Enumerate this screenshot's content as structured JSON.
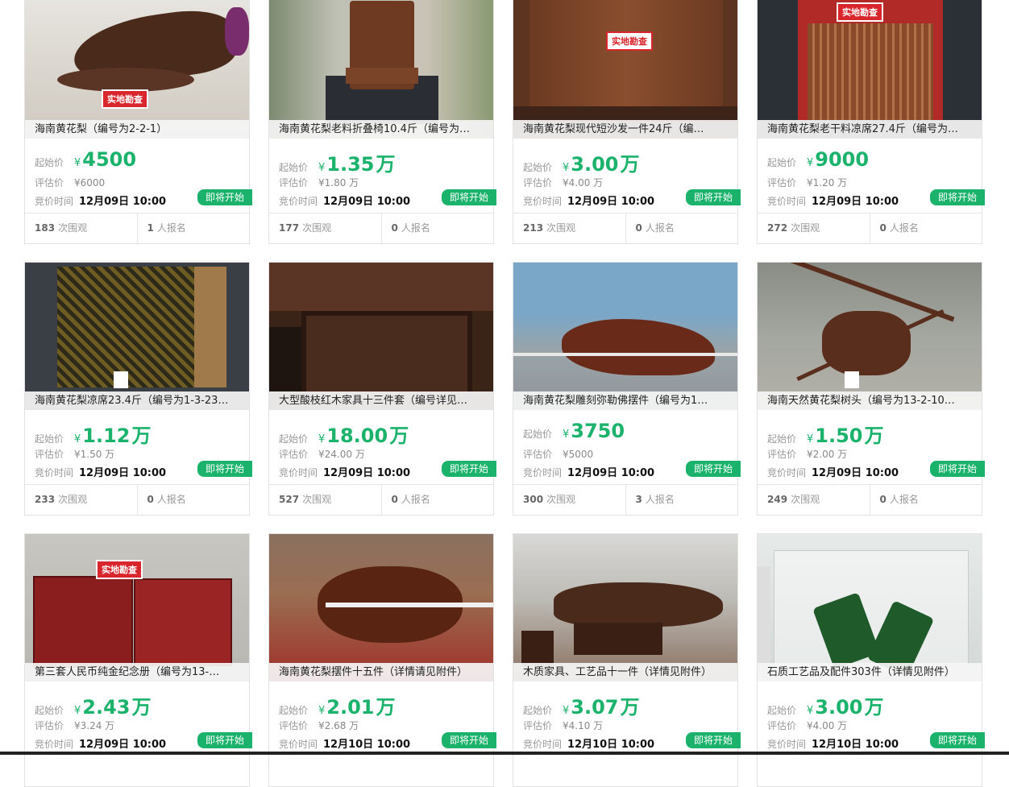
{
  "labels": {
    "start_price": "起始价",
    "eval_price": "评估价",
    "bid_time": "竞价时间",
    "yen": "¥",
    "status": "即将开始",
    "views_suffix": "次围观",
    "signup_suffix": "人报名"
  },
  "sign_text": "实地勘查",
  "colors": {
    "accent": "#1bb36b",
    "sign": "#d8262c"
  },
  "items": [
    {
      "title": "海南黄花梨（编号为2-2-1）",
      "price_num": "4500",
      "price_unit": "",
      "eval": "¥6000",
      "time": "12月09日 10:00",
      "views": "183",
      "signups": "1"
    },
    {
      "title": "海南黄花梨老料折叠椅10.4斤（编号为…",
      "price_num": "1.35",
      "price_unit": "万",
      "eval": "¥1.80 万",
      "time": "12月09日 10:00",
      "views": "177",
      "signups": "0"
    },
    {
      "title": "海南黄花梨现代短沙发一件24斤（编…",
      "price_num": "3.00",
      "price_unit": "万",
      "eval": "¥4.00 万",
      "time": "12月09日 10:00",
      "views": "213",
      "signups": "0"
    },
    {
      "title": "海南黄花梨老干料凉席27.4斤（编号为…",
      "price_num": "9000",
      "price_unit": "",
      "eval": "¥1.20 万",
      "time": "12月09日 10:00",
      "views": "272",
      "signups": "0"
    },
    {
      "title": "海南黄花梨凉席23.4斤（编号为1-3-23…",
      "price_num": "1.12",
      "price_unit": "万",
      "eval": "¥1.50 万",
      "time": "12月09日 10:00",
      "views": "233",
      "signups": "0"
    },
    {
      "title": "大型酸枝红木家具十三件套（编号详见…",
      "price_num": "18.00",
      "price_unit": "万",
      "eval": "¥24.00 万",
      "time": "12月09日 10:00",
      "views": "527",
      "signups": "0"
    },
    {
      "title": "海南黄花梨雕刻弥勒佛摆件（编号为1…",
      "price_num": "3750",
      "price_unit": "",
      "eval": "¥5000",
      "time": "12月09日 10:00",
      "views": "300",
      "signups": "3"
    },
    {
      "title": "海南天然黄花梨树头（编号为13-2-10…",
      "price_num": "1.50",
      "price_unit": "万",
      "eval": "¥2.00 万",
      "time": "12月09日 10:00",
      "views": "249",
      "signups": "0"
    },
    {
      "title": "第三套人民币纯金纪念册（编号为13-…",
      "price_num": "2.43",
      "price_unit": "万",
      "eval": "¥3.24 万",
      "time": "12月09日 10:00",
      "views": "",
      "signups": ""
    },
    {
      "title": "海南黄花梨摆件十五件（详情请见附件）",
      "price_num": "2.01",
      "price_unit": "万",
      "eval": "¥2.68 万",
      "time": "12月10日 10:00",
      "views": "",
      "signups": ""
    },
    {
      "title": "木质家具、工艺品十一件（详情见附件）",
      "price_num": "3.07",
      "price_unit": "万",
      "eval": "¥4.10 万",
      "time": "12月10日 10:00",
      "views": "",
      "signups": ""
    },
    {
      "title": "石质工艺品及配件303件（详情见附件）",
      "price_num": "3.00",
      "price_unit": "万",
      "eval": "¥4.00 万",
      "time": "12月10日 10:00",
      "views": "",
      "signups": ""
    }
  ]
}
